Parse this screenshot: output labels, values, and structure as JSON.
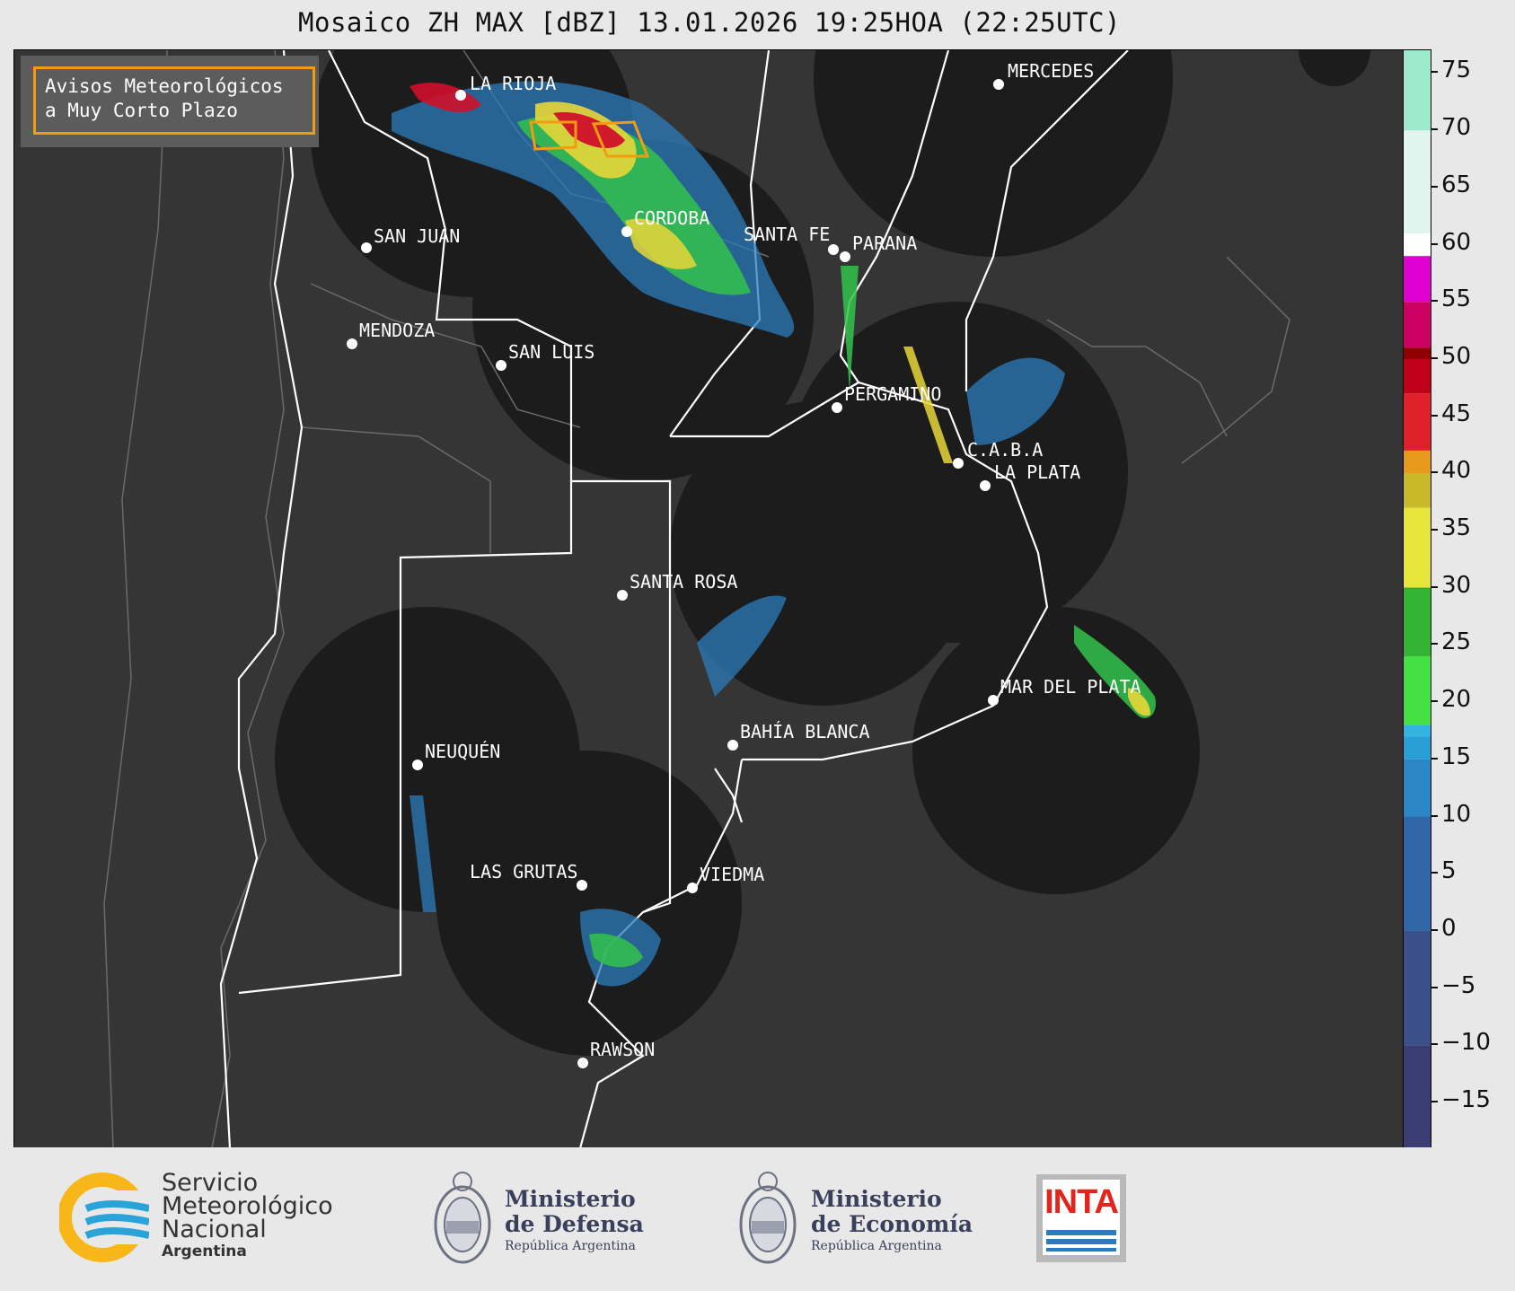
{
  "title": "Mosaico ZH MAX [dBZ] 13.01.2026 19:25HOA (22:25UTC)",
  "legend": {
    "line1": "Avisos Meteorológicos",
    "line2": "a Muy Corto Plazo",
    "color": "#f39c12"
  },
  "cities": [
    {
      "name": "LA RIOJA"
    },
    {
      "name": "MERCEDES"
    },
    {
      "name": "CORDOBA"
    },
    {
      "name": "SAN JUAN"
    },
    {
      "name": "SANTA FE"
    },
    {
      "name": "PARANA"
    },
    {
      "name": "MENDOZA"
    },
    {
      "name": "SAN LUIS"
    },
    {
      "name": "PERGAMINO"
    },
    {
      "name": "C.A.B.A"
    },
    {
      "name": "LA PLATA"
    },
    {
      "name": "SANTA ROSA"
    },
    {
      "name": "MAR DEL PLATA"
    },
    {
      "name": "BAHÍA BLANCA"
    },
    {
      "name": "NEUQUÉN"
    },
    {
      "name": "LAS GRUTAS"
    },
    {
      "name": "VIEDMA"
    },
    {
      "name": "RAWSON"
    }
  ],
  "colorbar": {
    "unit": "dBZ",
    "min": -19,
    "max": 77,
    "ticks": [
      "75",
      "70",
      "65",
      "60",
      "55",
      "50",
      "45",
      "40",
      "35",
      "30",
      "25",
      "20",
      "15",
      "10",
      "5",
      "0",
      "−5",
      "−10",
      "−15"
    ],
    "tick_values": [
      75,
      70,
      65,
      60,
      55,
      50,
      45,
      40,
      35,
      30,
      25,
      20,
      15,
      10,
      5,
      0,
      -5,
      -10,
      -15
    ]
  },
  "footer": {
    "smn": {
      "line1": "Servicio",
      "line2": "Meteorológico",
      "line3": "Nacional",
      "line4": "Argentina"
    },
    "defensa": {
      "line1": "Ministerio",
      "line2": "de Defensa",
      "line3": "República Argentina"
    },
    "economia": {
      "line1": "Ministerio",
      "line2": "de Economía",
      "line3": "República Argentina"
    },
    "inta": {
      "text": "INTA"
    }
  }
}
